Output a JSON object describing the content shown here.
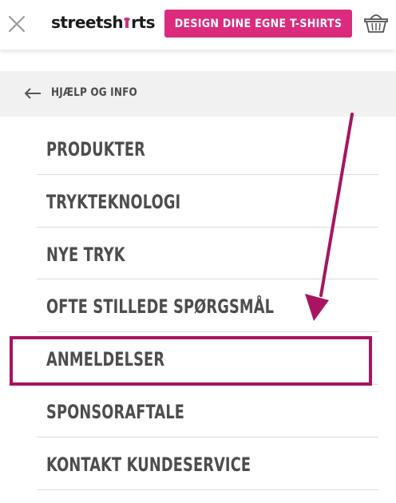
{
  "header": {
    "close_icon": "close-icon",
    "logo_prefix": "streetsh",
    "logo_suffix": "rts",
    "cta_label": "DESIGN DINE EGNE T-SHIRTS",
    "basket_icon": "basket-icon",
    "brand_color": "#dc2b7c"
  },
  "back": {
    "label": "HJÆLP OG INFO",
    "icon": "arrow-left-icon"
  },
  "menu": {
    "items": [
      {
        "label": "PRODUKTER"
      },
      {
        "label": "TRYKTEKNOLOGI"
      },
      {
        "label": "NYE TRYK"
      },
      {
        "label": "OFTE STILLEDE SPØRGSMÅL"
      },
      {
        "label": "ANMELDELSER"
      },
      {
        "label": "SPONSORAFTALE"
      },
      {
        "label": "KONTAKT KUNDESERVICE"
      }
    ],
    "highlighted_item": "ANMELDELSER"
  },
  "annotation": {
    "color": "#a8145f"
  }
}
